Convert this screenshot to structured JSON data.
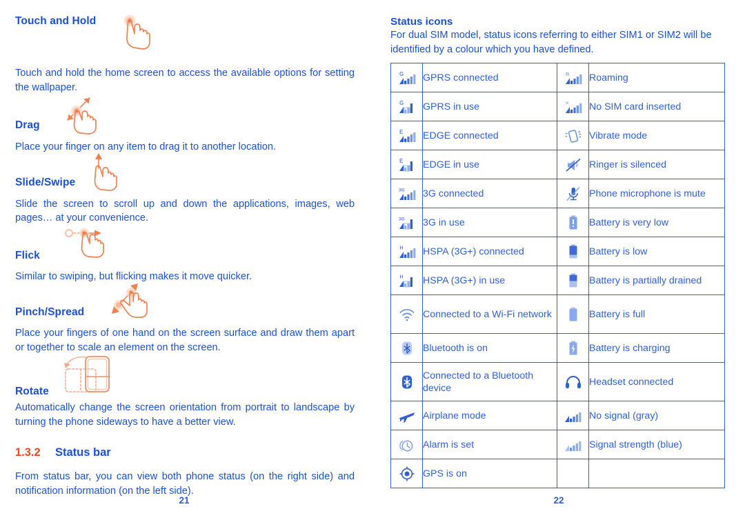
{
  "colors": {
    "heading_blue": "#1a4fd6",
    "body_blue": "#2f5fd0",
    "accent_orange": "#e8491e",
    "gesture_orange": "#f08254",
    "table_border": "#2f5fd0"
  },
  "left_column": {
    "gestures": [
      {
        "title": "Touch and Hold",
        "body": "Touch and hold the home screen to access the available options for setting the wallpaper.",
        "icon": "hand-touch-hold-icon"
      },
      {
        "title": "Drag",
        "body": "Place your finger on any item to drag it to another location.",
        "icon": "hand-drag-icon"
      },
      {
        "title": "Slide/Swipe",
        "body": "Slide the screen to scroll up and down the applications, images, web pages… at your convenience.",
        "icon": "hand-slide-icon"
      },
      {
        "title": "Flick",
        "body": "Similar to swiping, but flicking makes it move quicker.",
        "icon": "hand-flick-icon"
      },
      {
        "title": "Pinch/Spread",
        "body": "Place your fingers of one hand on the screen surface and draw them apart or together to scale an element on the screen.",
        "icon": "hand-pinch-spread-icon"
      },
      {
        "title": "Rotate",
        "body": "Automatically change the screen orientation from portrait to landscape by turning the phone sideways to have a better view.",
        "icon": "phone-rotate-icon"
      }
    ],
    "section": {
      "number": "1.3.2",
      "title": "Status bar",
      "body": "From status bar, you can view both phone status (on the right side) and notification information (on the left side)."
    },
    "page_number": "21"
  },
  "right_column": {
    "heading": "Status icons",
    "intro": "For dual SIM model, status icons referring to either SIM1 or SIM2 will be identified by a colour which you have defined.",
    "table_rows": [
      {
        "left": {
          "icon": "signal-gprs-connected-icon",
          "label": "GPRS connected"
        },
        "right": {
          "icon": "signal-roaming-icon",
          "label": "Roaming"
        }
      },
      {
        "left": {
          "icon": "signal-gprs-in-use-icon",
          "label": "GPRS in use"
        },
        "right": {
          "icon": "signal-no-sim-icon",
          "label": "No SIM card inserted"
        }
      },
      {
        "left": {
          "icon": "signal-edge-connected-icon",
          "label": "EDGE connected"
        },
        "right": {
          "icon": "vibrate-mode-icon",
          "label": "Vibrate mode"
        }
      },
      {
        "left": {
          "icon": "signal-edge-in-use-icon",
          "label": "EDGE in use"
        },
        "right": {
          "icon": "ringer-silenced-icon",
          "label": "Ringer is silenced"
        }
      },
      {
        "left": {
          "icon": "signal-3g-connected-icon",
          "label": "3G connected"
        },
        "right": {
          "icon": "microphone-mute-icon",
          "label": "Phone microphone is mute"
        }
      },
      {
        "left": {
          "icon": "signal-3g-in-use-icon",
          "label": "3G in use"
        },
        "right": {
          "icon": "battery-very-low-icon",
          "label": "Battery is very low"
        }
      },
      {
        "left": {
          "icon": "signal-hspa-connected-icon",
          "label": "HSPA (3G+) connected"
        },
        "right": {
          "icon": "battery-low-icon",
          "label": "Battery is low"
        }
      },
      {
        "left": {
          "icon": "signal-hspa-in-use-icon",
          "label": "HSPA (3G+) in use"
        },
        "right": {
          "icon": "battery-partial-icon",
          "label": "Battery is partially drained"
        }
      },
      {
        "left": {
          "icon": "wifi-connected-icon",
          "label": "Connected to a Wi-Fi network"
        },
        "right": {
          "icon": "battery-full-icon",
          "label": "Battery is full"
        }
      },
      {
        "left": {
          "icon": "bluetooth-on-icon",
          "label": "Bluetooth is on"
        },
        "right": {
          "icon": "battery-charging-icon",
          "label": "Battery is charging"
        }
      },
      {
        "left": {
          "icon": "bluetooth-connected-icon",
          "label": "Connected to a Bluetooth device"
        },
        "right": {
          "icon": "headset-connected-icon",
          "label": "Headset connected"
        }
      },
      {
        "left": {
          "icon": "airplane-mode-icon",
          "label": "Airplane mode"
        },
        "right": {
          "icon": "signal-no-signal-icon",
          "label": "No signal (gray)"
        }
      },
      {
        "left": {
          "icon": "alarm-set-icon",
          "label": "Alarm is set"
        },
        "right": {
          "icon": "signal-strength-icon",
          "label": "Signal strength (blue)"
        }
      },
      {
        "left": {
          "icon": "gps-on-icon",
          "label": "GPS is on"
        },
        "right": {
          "icon": "",
          "label": ""
        }
      }
    ],
    "page_number": "22"
  }
}
